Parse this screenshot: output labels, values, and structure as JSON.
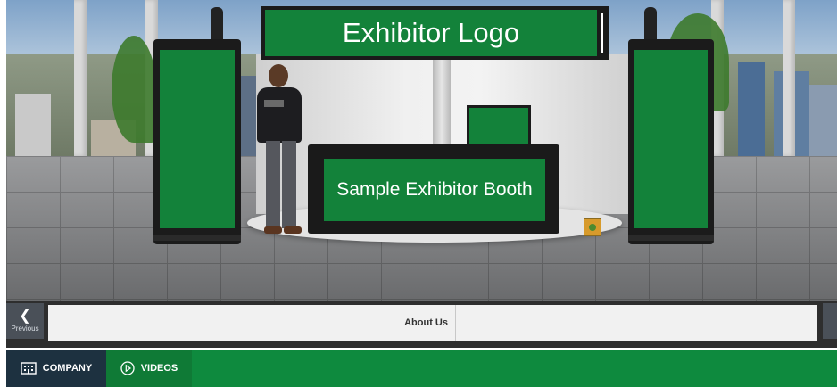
{
  "booth": {
    "header_sign_text": "Exhibitor Logo",
    "desk_sign_text": "Sample Exhibitor Booth"
  },
  "nav": {
    "previous_label": "Previous",
    "previous_icon": "chevron-left-icon",
    "tabs": [
      {
        "label": "About Us"
      }
    ]
  },
  "menu": {
    "items": [
      {
        "label": "COMPANY",
        "icon": "building-icon"
      },
      {
        "label": "VIDEOS",
        "icon": "play-circle-icon"
      }
    ]
  },
  "colors": {
    "booth_green": "#13823a",
    "menu_green": "#0e8a3e",
    "company_tab_bg": "#1d3140",
    "nav_bar_bg": "#2e2e2e"
  }
}
